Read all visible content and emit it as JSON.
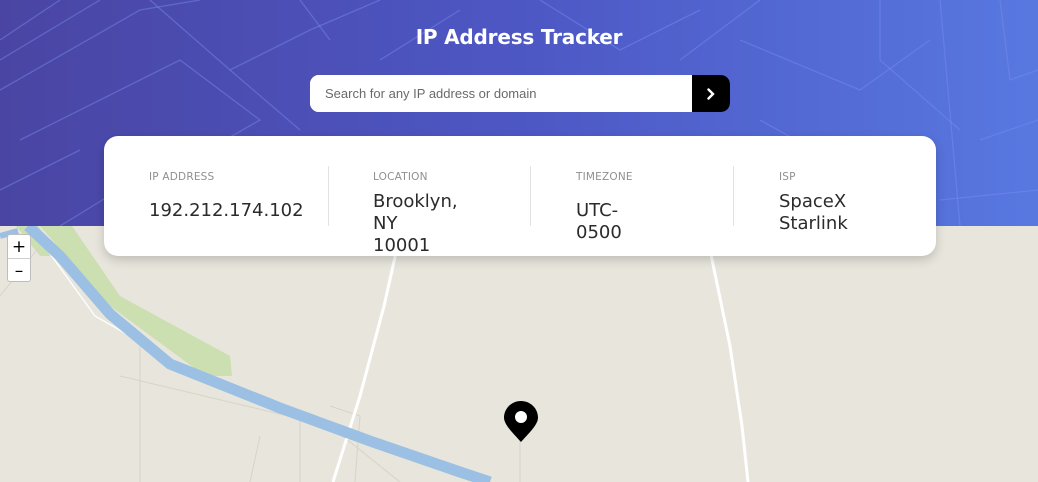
{
  "header": {
    "title": "IP Address Tracker"
  },
  "search": {
    "placeholder": "Search for any IP address or domain",
    "value": "",
    "submit_icon": "chevron-right-icon"
  },
  "info": {
    "ip": {
      "label": "IP ADDRESS",
      "value": "192.212.174.102"
    },
    "location": {
      "label": "LOCATION",
      "value_line1": "Brooklyn, NY",
      "value_line2": "10001"
    },
    "timezone": {
      "label": "TIMEZONE",
      "value": "UTC-0500"
    },
    "isp": {
      "label": "ISP",
      "value_line1": "SpaceX",
      "value_line2": "Starlink"
    }
  },
  "map": {
    "zoom_in": "+",
    "zoom_out": "–",
    "marker_icon": "location-pin-icon",
    "colors": {
      "land": "#e8e6dc",
      "water": "#9cc0e4",
      "park": "#cbdfb0",
      "road": "#ffffff"
    }
  },
  "colors": {
    "header_start": "#4a45a3",
    "header_end": "#5878e0",
    "button": "#000000"
  }
}
